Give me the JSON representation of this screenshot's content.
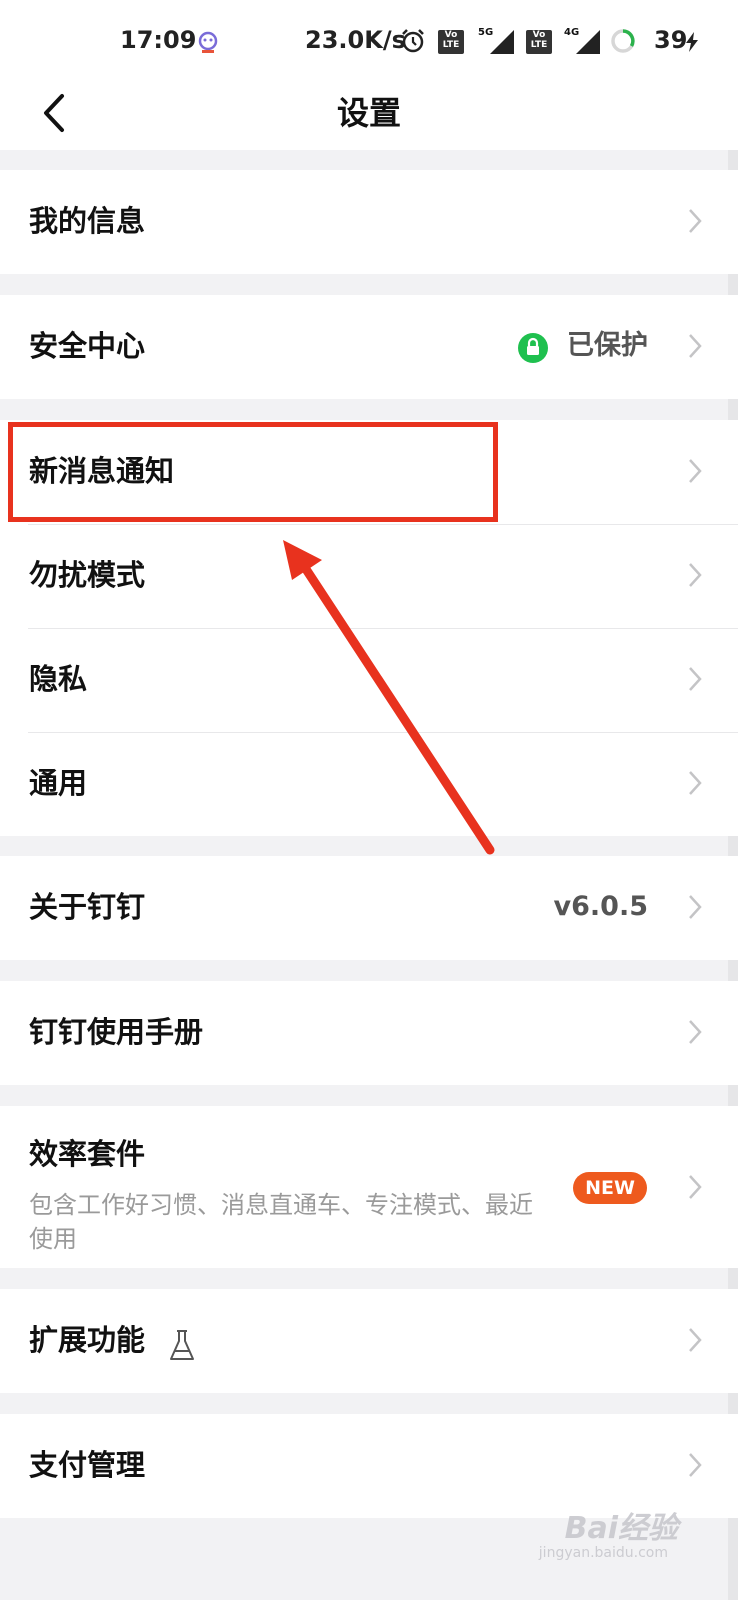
{
  "status_bar": {
    "time": "17:09",
    "net_speed": "23.0K/s",
    "battery": "39",
    "sim1_label": "Vo LTE",
    "sim1_network": "5G",
    "sim2_label": "Vo LTE",
    "sim2_network": "4G"
  },
  "nav": {
    "title": "设置"
  },
  "groups": [
    {
      "items": [
        {
          "label": "我的信息"
        }
      ]
    },
    {
      "items": [
        {
          "label": "安全中心",
          "value": "已保护"
        }
      ]
    },
    {
      "items": [
        {
          "label": "新消息通知"
        },
        {
          "label": "勿扰模式"
        },
        {
          "label": "隐私"
        },
        {
          "label": "通用"
        }
      ]
    },
    {
      "items": [
        {
          "label": "关于钉钉",
          "value": "v6.0.5"
        }
      ]
    },
    {
      "items": [
        {
          "label": "钉钉使用手册"
        }
      ]
    },
    {
      "items": [
        {
          "label": "效率套件",
          "subtitle": "包含工作好习惯、消息直通车、专注模式、最近使用",
          "badge": "NEW"
        }
      ]
    },
    {
      "items": [
        {
          "label": "扩展功能"
        }
      ]
    },
    {
      "items": [
        {
          "label": "支付管理"
        }
      ]
    }
  ],
  "watermark": {
    "brand": "Bai经验",
    "url": "jingyan.baidu.com"
  },
  "colors": {
    "highlight": "#e8321e",
    "lock_green": "#1fc04f",
    "badge_orange": "#ee5a1e"
  }
}
